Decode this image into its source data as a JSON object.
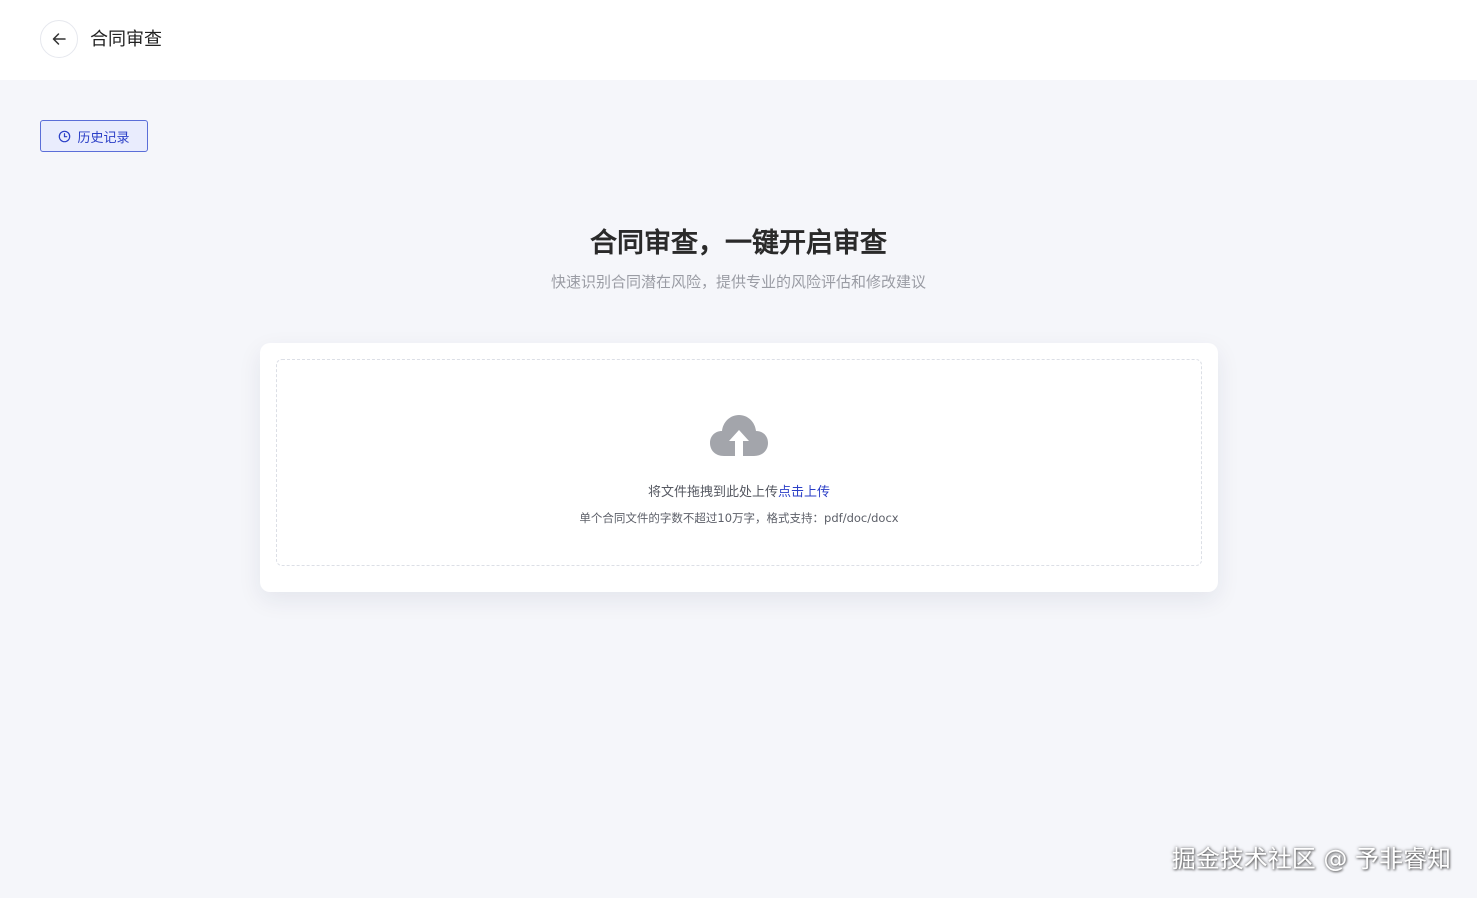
{
  "header": {
    "back_icon": "arrow-left-icon",
    "title": "合同审查"
  },
  "history_button": {
    "icon": "clock-icon",
    "label": "历史记录",
    "accent_color": "#2b3fc7"
  },
  "hero": {
    "title": "合同审查，一键开启审查",
    "subtitle": "快速识别合同潜在风险，提供专业的风险评估和修改建议"
  },
  "upload": {
    "icon": "cloud-upload-icon",
    "text_prefix": "将文件拖拽到此处上传",
    "text_link": "点击上传",
    "hint": "单个合同文件的字数不超过10万字，格式支持：pdf/doc/docx"
  },
  "watermark": "掘金技术社区 @ 予非睿知"
}
